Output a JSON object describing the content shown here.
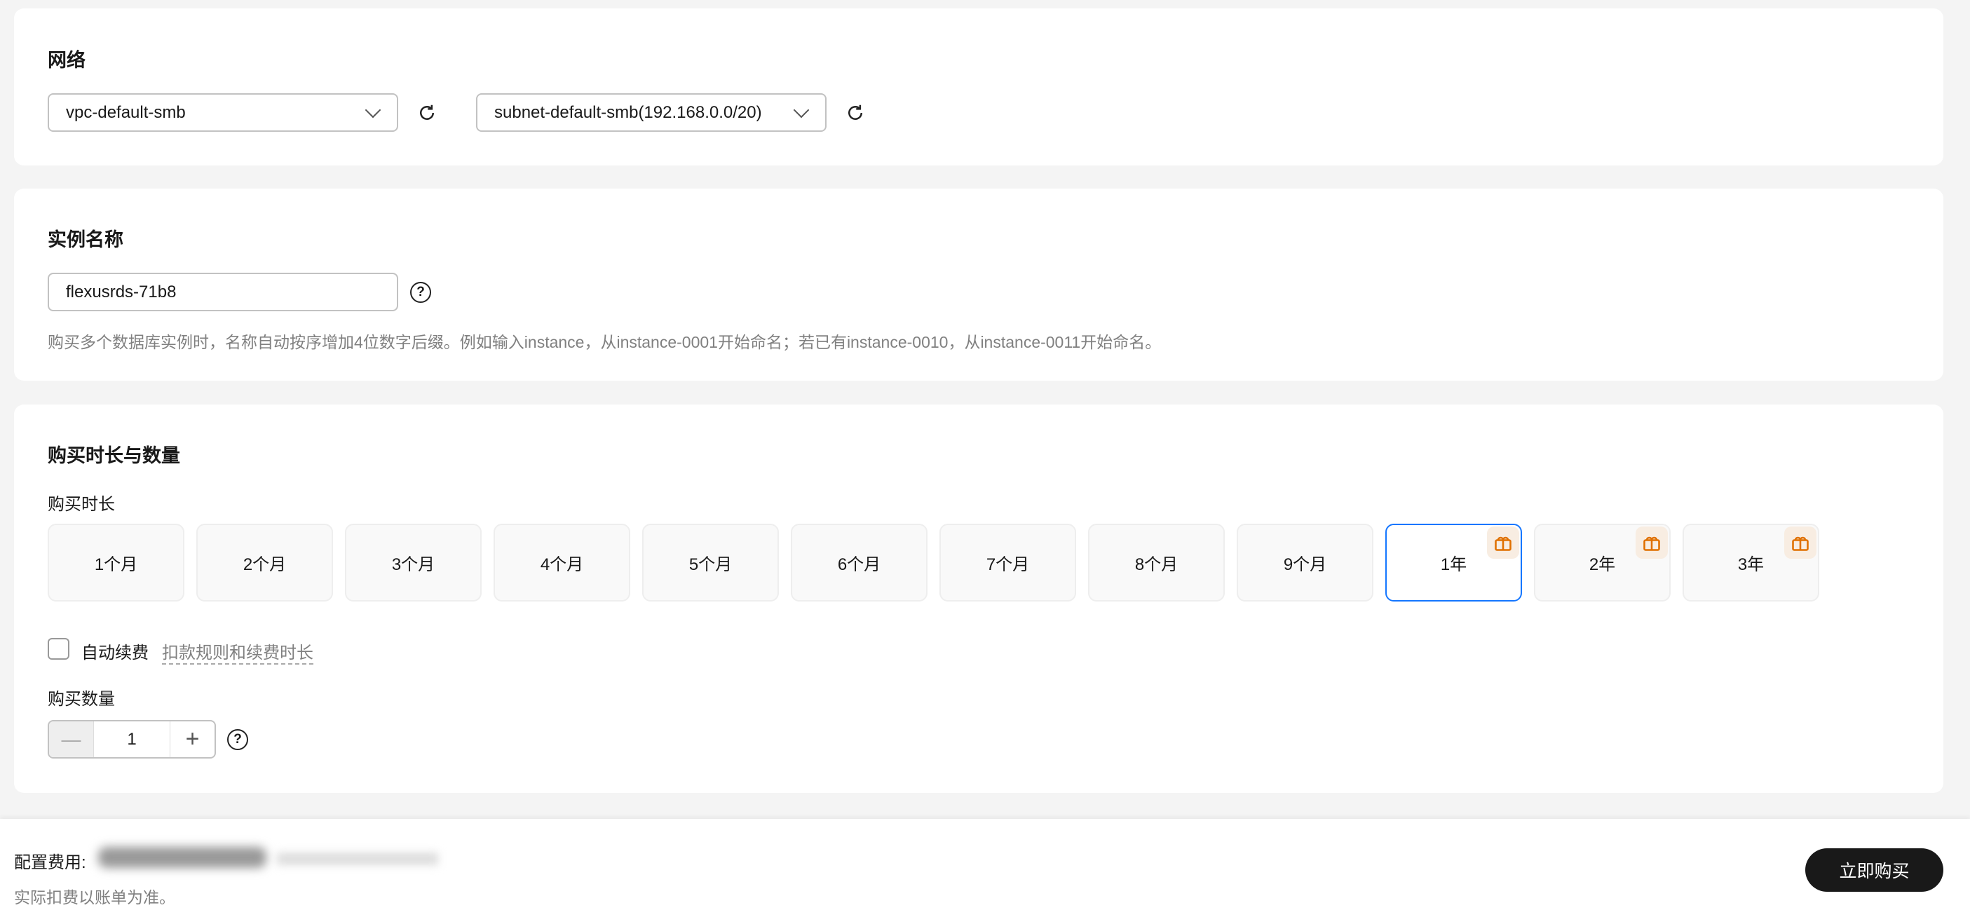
{
  "network": {
    "title": "网络",
    "vpc": "vpc-default-smb",
    "subnet": "subnet-default-smb(192.168.0.0/20)"
  },
  "instance": {
    "title": "实例名称",
    "name": "flexusrds-71b8",
    "hint": "购买多个数据库实例时，名称自动按序增加4位数字后缀。例如输入instance，从instance-0001开始命名；若已有instance-0010，从instance-0011开始命名。"
  },
  "purchase": {
    "title": "购买时长与数量",
    "duration_label": "购买时长",
    "durations": [
      {
        "label": "1个月"
      },
      {
        "label": "2个月"
      },
      {
        "label": "3个月"
      },
      {
        "label": "4个月"
      },
      {
        "label": "5个月"
      },
      {
        "label": "6个月"
      },
      {
        "label": "7个月"
      },
      {
        "label": "8个月"
      },
      {
        "label": "9个月"
      },
      {
        "label": "1年",
        "gift": true,
        "selected": true
      },
      {
        "label": "2年",
        "gift": true
      },
      {
        "label": "3年",
        "gift": true
      }
    ],
    "auto_renew": "自动续费",
    "renew_link": "扣款规则和续费时长",
    "quantity_label": "购买数量",
    "quantity": "1"
  },
  "footer": {
    "fee_label": "配置费用:",
    "note": "实际扣费以账单为准。",
    "buy": "立即购买"
  },
  "colors": {
    "accent": "#1476ff",
    "gift": "#e07000"
  }
}
